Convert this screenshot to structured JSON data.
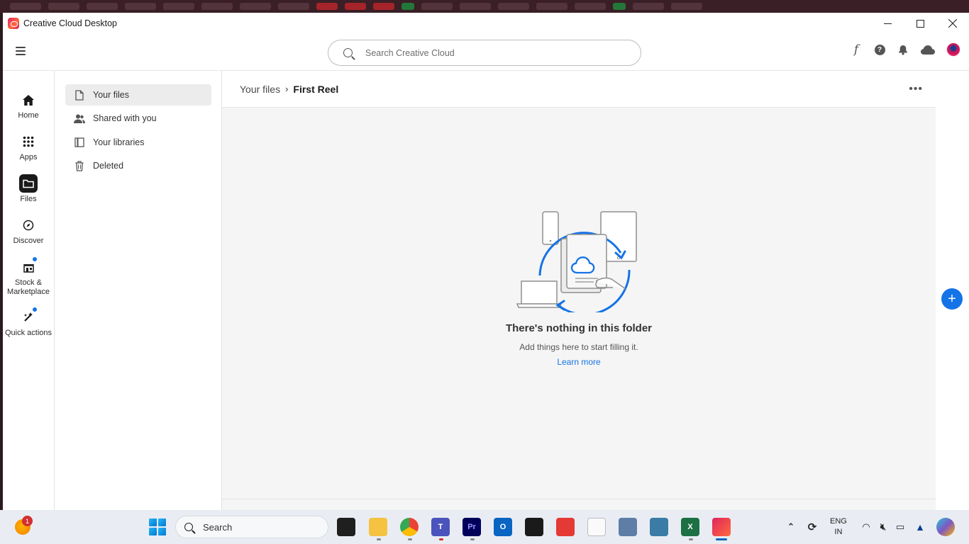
{
  "window": {
    "title": "Creative Cloud Desktop"
  },
  "search": {
    "placeholder": "Search Creative Cloud"
  },
  "rail": {
    "items": [
      {
        "label": "Home",
        "icon": "home-icon"
      },
      {
        "label": "Apps",
        "icon": "apps-grid-icon"
      },
      {
        "label": "Files",
        "icon": "folder-icon",
        "active": true
      },
      {
        "label": "Discover",
        "icon": "compass-icon"
      },
      {
        "label": "Stock & Marketplace",
        "label_line1": "Stock &",
        "label_line2": "Marketplace",
        "icon": "stock-icon",
        "notification": true
      },
      {
        "label": "Quick actions",
        "icon": "quick-actions-icon",
        "notification": true
      }
    ]
  },
  "subnav": {
    "items": [
      {
        "label": "Your files",
        "icon": "document-icon",
        "active": true
      },
      {
        "label": "Shared with you",
        "icon": "people-icon"
      },
      {
        "label": "Your libraries",
        "icon": "library-icon"
      },
      {
        "label": "Deleted",
        "icon": "trash-icon"
      }
    ]
  },
  "breadcrumb": {
    "parent": "Your files",
    "separator": "›",
    "current": "First Reel"
  },
  "empty_state": {
    "title": "There's nothing in this folder",
    "subtitle": "Add things here to start filling it.",
    "link": "Learn more"
  },
  "taskbar": {
    "weather_badge": "1",
    "search_label": "Search",
    "language": "ENG",
    "region": "IN"
  },
  "colors": {
    "accent": "#1473e6",
    "rail_active": "#1a1a1a",
    "content_bg": "#f5f5f5"
  }
}
